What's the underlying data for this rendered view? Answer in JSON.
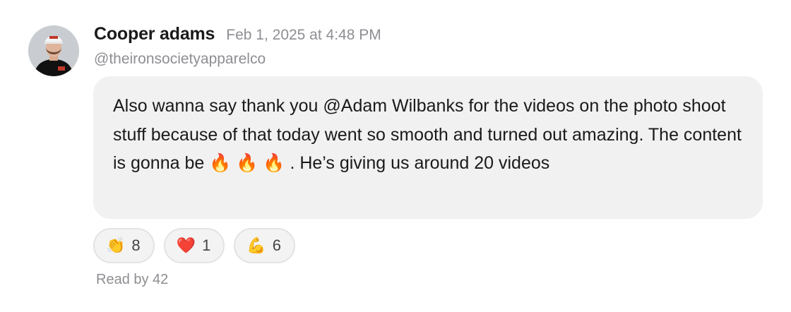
{
  "post": {
    "author_name": "Cooper adams",
    "timestamp": "Feb 1, 2025 at 4:48 PM",
    "handle": "@theironsocietyapparelco",
    "avatar_icon": "person-avatar",
    "message": "Also wanna say thank you @Adam Wilbanks for the videos on the photo shoot stuff because of that today went so smooth and turned out amazing. The content is gonna be 🔥 🔥 🔥 . He’s giving us around 20 videos"
  },
  "reactions": [
    {
      "emoji": "👏",
      "icon": "clapping-hands-icon",
      "count": "8"
    },
    {
      "emoji": "❤️",
      "icon": "red-heart-icon",
      "count": "1"
    },
    {
      "emoji": "💪",
      "icon": "flexed-biceps-icon",
      "count": "6"
    }
  ],
  "read_by": "Read by 42",
  "colors": {
    "bubble_background": "#f1f1f1",
    "secondary_text": "#8e8e93",
    "primary_text": "#1a1a1a"
  }
}
